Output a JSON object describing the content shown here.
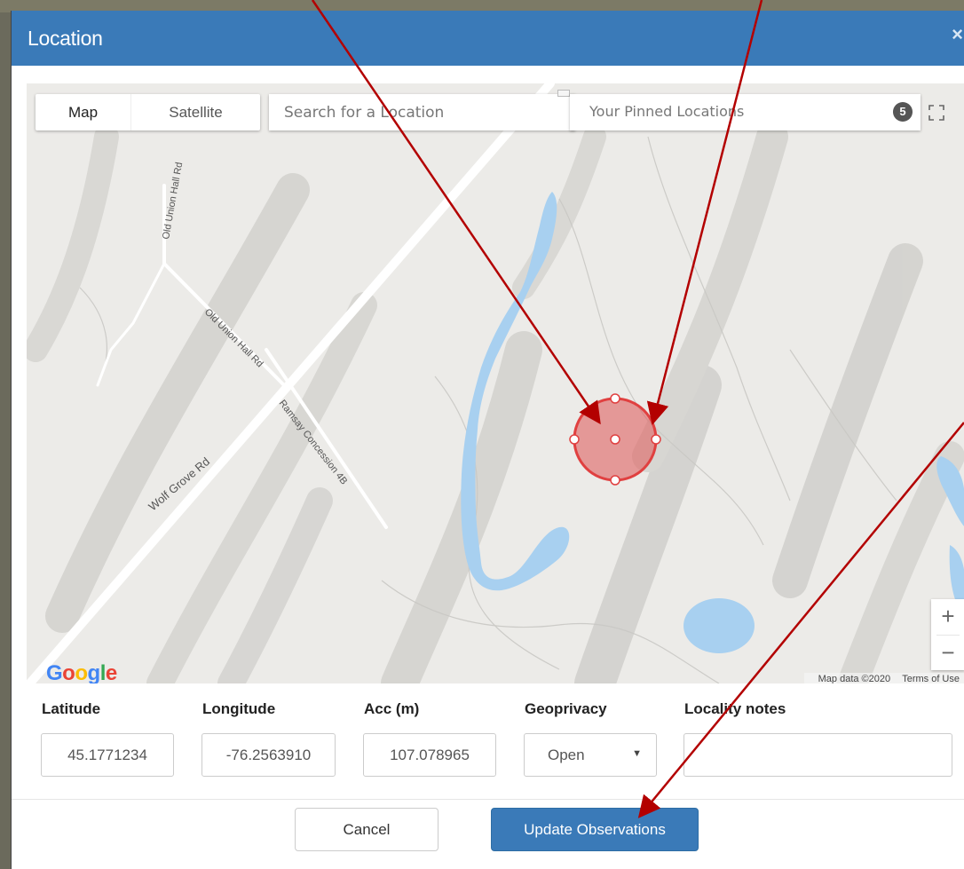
{
  "modal": {
    "title": "Location",
    "close_symbol": "×"
  },
  "map": {
    "map_types": [
      "Map",
      "Satellite"
    ],
    "selected_map_type": "Map",
    "search_placeholder": "Search for a Location",
    "pinned_label": "Your Pinned Locations",
    "pinned_count": "5",
    "fullscreen_icon": "fullscreen-icon",
    "roads": [
      "Old Union Hall Rd",
      "Old Union Hall Rd",
      "Wolf Grove Rd",
      "Ramsay Concession 4B"
    ],
    "logo_text": "Google",
    "attribution": "Map data ©2020",
    "terms": "Terms of Use",
    "zoom_in": "+",
    "zoom_out": "−",
    "accuracy_circle_color": "#e06060",
    "water_color": "#a8d0f0"
  },
  "fields": {
    "latitude": {
      "label": "Latitude",
      "value": "45.1771234"
    },
    "longitude": {
      "label": "Longitude",
      "value": "-76.2563910"
    },
    "accuracy": {
      "label": "Acc (m)",
      "value": "107.078965"
    },
    "geoprivacy": {
      "label": "Geoprivacy",
      "value": "Open"
    },
    "locality": {
      "label": "Locality notes",
      "value": ""
    }
  },
  "footer": {
    "cancel_label": "Cancel",
    "update_label": "Update Observations"
  },
  "colors": {
    "header_blue": "#3a7ab8",
    "annotation_arrow": "#b30000"
  }
}
